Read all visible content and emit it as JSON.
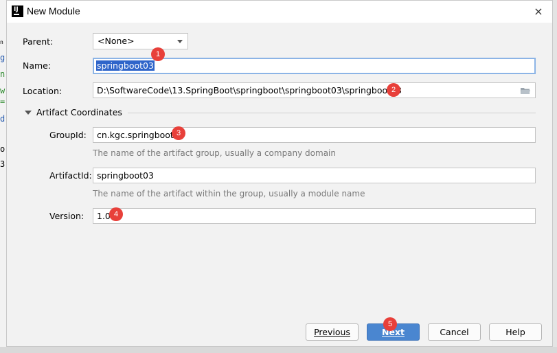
{
  "background": {
    "strip_chars": [
      "n",
      "g",
      "n",
      "w",
      "=",
      "d",
      "o",
      "3"
    ]
  },
  "dialog": {
    "title": "New Module",
    "close_icon": "×"
  },
  "form": {
    "parent_label": "Parent:",
    "parent_value": "<None>",
    "name_label": "Name:",
    "name_value": "springboot03",
    "location_label": "Location:",
    "location_value": "D:\\SoftwareCode\\13.SpringBoot\\springboot\\springboot03\\springboot03",
    "section_title": "Artifact Coordinates",
    "groupid_label": "GroupId:",
    "groupid_value": "cn.kgc.springboot",
    "groupid_hint": "The name of the artifact group, usually a company domain",
    "artifactid_label": "ArtifactId:",
    "artifactid_value": "springboot03",
    "artifactid_hint": "The name of the artifact within the group, usually a module name",
    "version_label": "Version:",
    "version_value": "1.0"
  },
  "badges": [
    "1",
    "2",
    "3",
    "4",
    "5"
  ],
  "buttons": {
    "previous": "Previous",
    "next": "Next",
    "cancel": "Cancel",
    "help": "Help"
  },
  "colors": {
    "accent": "#4a86d0",
    "badge": "#e8403a",
    "selection": "#2f65ca"
  }
}
